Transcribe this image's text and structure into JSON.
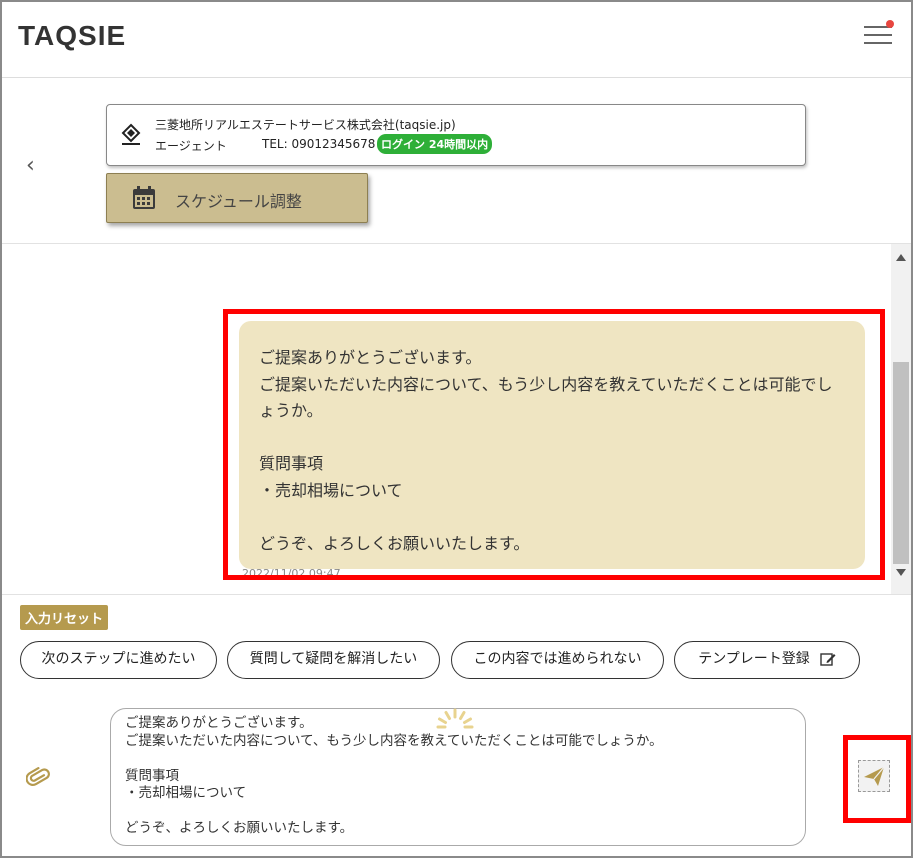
{
  "header": {
    "logo_text": "TAQSIE",
    "menu_icon": "hamburger-menu-icon",
    "notification_color": "#e8463f"
  },
  "agent": {
    "company": "三菱地所リアルエステートサービス株式会社(taqsie.jp)",
    "role": "エージェント",
    "tel": "TEL: 09012345678",
    "login_status": "ログイン 24時間以内"
  },
  "schedule": {
    "label": "スケジュール調整"
  },
  "chat": {
    "message": "ご提案ありがとうございます。\nご提案いただいた内容について、もう少し内容を教えていただくことは可能でしょうか。\n\n質問事項\n・売却相場について\n\nどうぞ、よろしくお願いいたします。",
    "timestamp": "2022/11/02 09:47"
  },
  "input": {
    "reset_label": "入力リセット",
    "templates": [
      "次のステップに進めたい",
      "質問して疑問を解消したい",
      "この内容では進められない",
      "テンプレート登録"
    ],
    "composer_text": "ご提案ありがとうございます。\nご提案いただいた内容について、もう少し内容を教えていただくことは可能でしょうか。\n\n質問事項\n・売却相場について\n\nどうぞ、よろしくお願いいたします。"
  },
  "colors": {
    "accent": "#b59a4e",
    "bubble": "#efe5c2",
    "highlight": "#ff0000",
    "login_badge": "#2eaf38"
  }
}
